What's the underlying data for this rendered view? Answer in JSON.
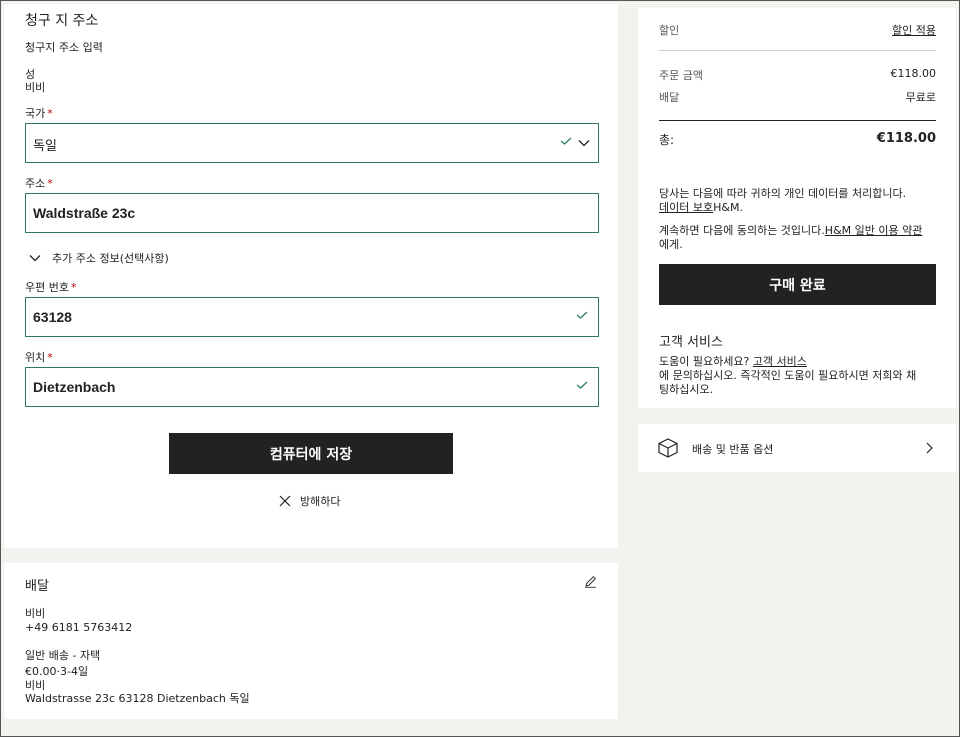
{
  "billing": {
    "title": "청구 지 주소",
    "subtitle": "청구지 주소 입력",
    "last_name_label": "성",
    "last_name_value": "비비",
    "country_label": "국가",
    "country_value": "독일",
    "address_label": "주소",
    "address_value": "Waldstraße 23c",
    "additional_info": "추가 주소 정보(선택사항)",
    "postal_label": "우편 번호",
    "postal_value": "63128",
    "city_label": "위치",
    "city_value": "Dietzenbach",
    "save_button": "컴퓨터에 저장",
    "cancel_label": "방해하다",
    "required_mark": "*"
  },
  "delivery": {
    "title": "배달",
    "name": "비비",
    "phone": "+49 6181 5763412",
    "method": "일반 배송 - 자택",
    "price_days": "€0.00·3-4일",
    "recipient": "비비",
    "address": "Waldstrasse 23c 63128 Dietzenbach 독일"
  },
  "summary": {
    "discount_label": "할인",
    "discount_link": "할인 적용",
    "order_amount_label": "주문 금액",
    "order_amount_value": "€118.00",
    "shipping_label": "배달",
    "shipping_value": "무료로",
    "total_label": "총:",
    "total_value": "€118.00",
    "privacy_text": "당사는 다음에 따라 귀하의 개인 데이터를 처리합니다.",
    "privacy_link": "데이터 보호",
    "privacy_suffix": "H&M.",
    "terms_prefix": "계속하면 다음에 동의하는 것입니다.",
    "terms_link": "H&M 일반 이용 약관",
    "terms_suffix": "에게.",
    "purchase_button": "구매 완료",
    "customer_service_title": "고객 서비스",
    "help_prefix": "도움이 필요하세요? ",
    "help_link": "고객 서비스",
    "help_line2": "에 문의하십시오. 즉각적인 도움이 필요하시면 저희와 채",
    "help_line3": "팅하십시오."
  },
  "shipping_options": {
    "label": "배송 및 반품 옵션"
  },
  "colors": {
    "accent_green": "#2e7d57",
    "required_red": "#c40000",
    "button_black": "#222222"
  },
  "icons": [
    "check-icon",
    "chevron-down-icon",
    "close-icon",
    "pencil-icon",
    "box-icon",
    "chevron-right-icon"
  ]
}
